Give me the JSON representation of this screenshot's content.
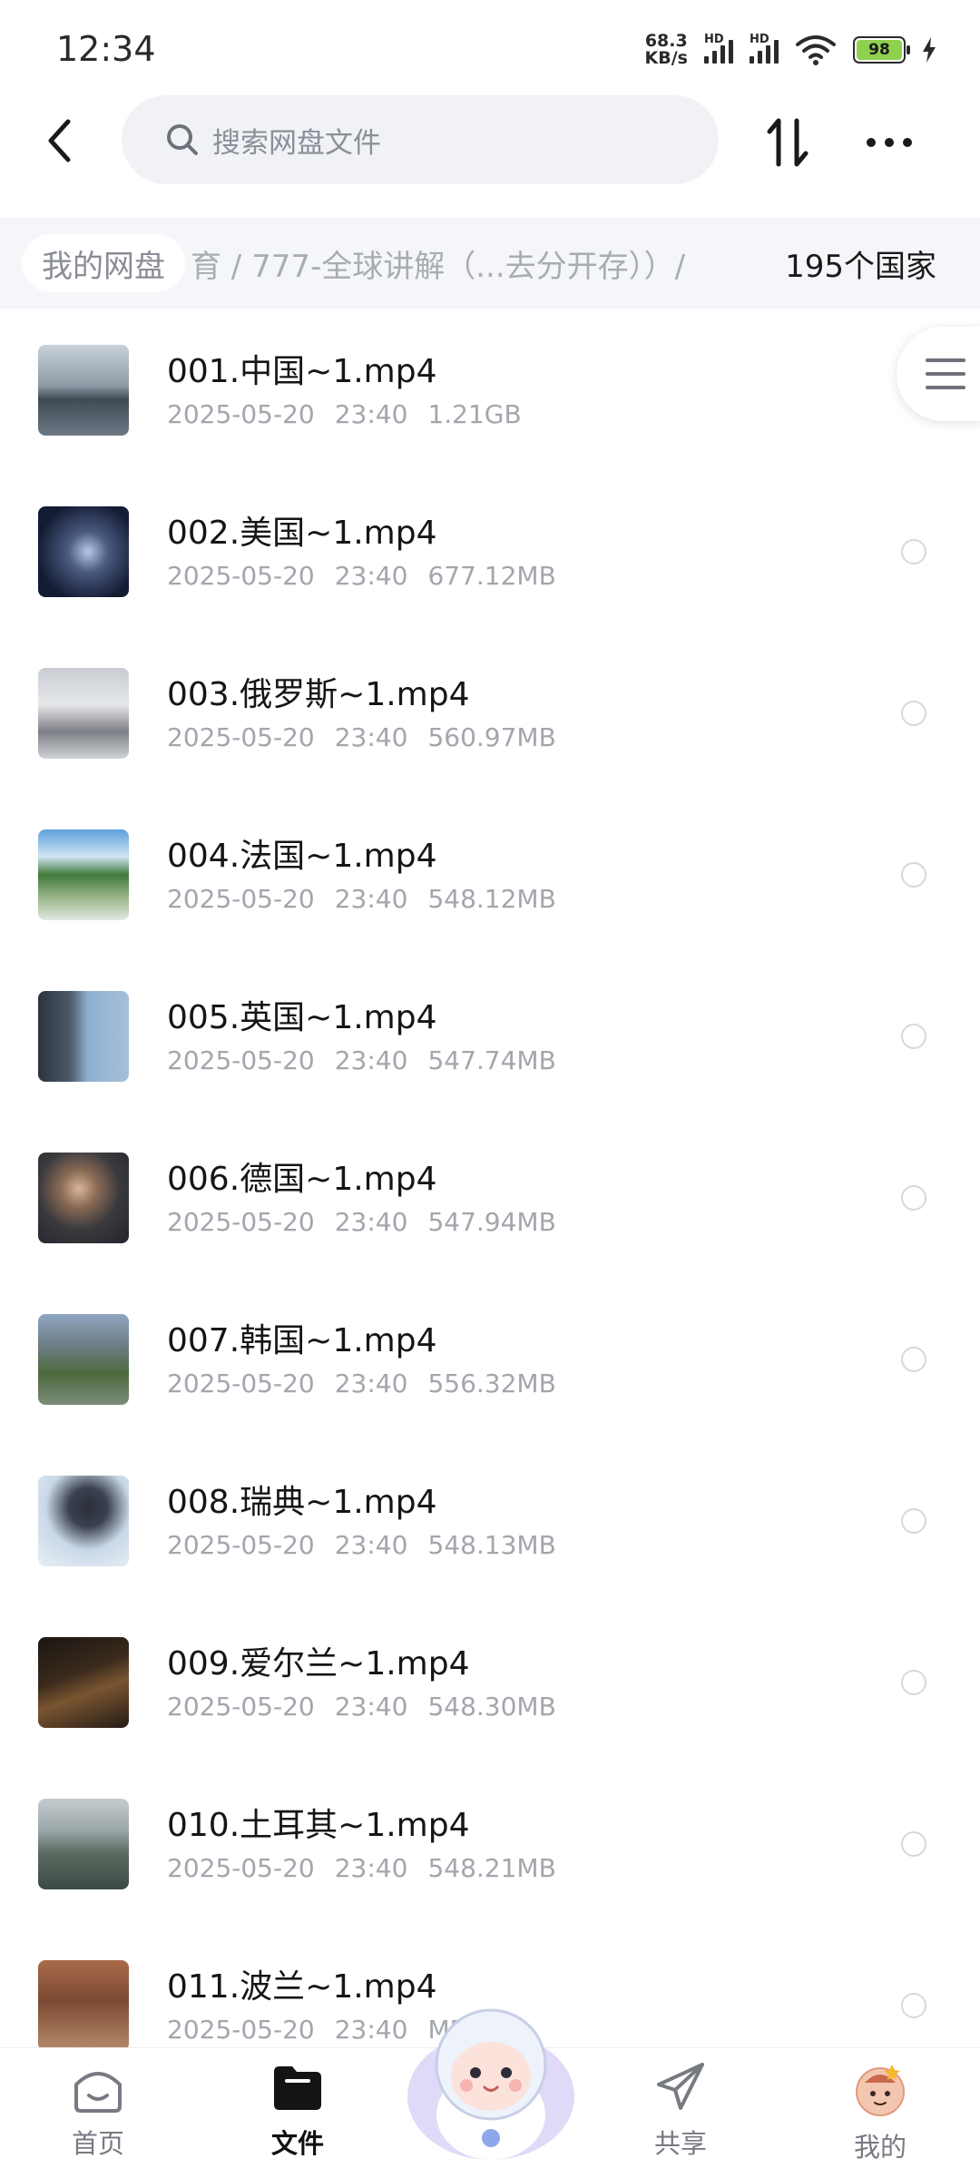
{
  "status_bar": {
    "time": "12:34",
    "net_speed_value": "68.3",
    "net_speed_unit": "KB/s",
    "signal_label": "HD",
    "battery": "98"
  },
  "search": {
    "placeholder": "搜索网盘文件"
  },
  "breadcrumb": {
    "home": "我的网盘",
    "middle": "育 / 777-全球讲解（...去分开存））/",
    "current": "195个国家"
  },
  "files": [
    {
      "name": "001.中国~1.mp4",
      "date": "2025-05-20",
      "time": "23:40",
      "size": "1.21GB"
    },
    {
      "name": "002.美国~1.mp4",
      "date": "2025-05-20",
      "time": "23:40",
      "size": "677.12MB"
    },
    {
      "name": "003.俄罗斯~1.mp4",
      "date": "2025-05-20",
      "time": "23:40",
      "size": "560.97MB"
    },
    {
      "name": "004.法国~1.mp4",
      "date": "2025-05-20",
      "time": "23:40",
      "size": "548.12MB"
    },
    {
      "name": "005.英国~1.mp4",
      "date": "2025-05-20",
      "time": "23:40",
      "size": "547.74MB"
    },
    {
      "name": "006.德国~1.mp4",
      "date": "2025-05-20",
      "time": "23:40",
      "size": "547.94MB"
    },
    {
      "name": "007.韩国~1.mp4",
      "date": "2025-05-20",
      "time": "23:40",
      "size": "556.32MB"
    },
    {
      "name": "008.瑞典~1.mp4",
      "date": "2025-05-20",
      "time": "23:40",
      "size": "548.13MB"
    },
    {
      "name": "009.爱尔兰~1.mp4",
      "date": "2025-05-20",
      "time": "23:40",
      "size": "548.30MB"
    },
    {
      "name": "010.土耳其~1.mp4",
      "date": "2025-05-20",
      "time": "23:40",
      "size": "548.21MB"
    },
    {
      "name": "011.波兰~1.mp4",
      "date": "2025-05-20",
      "time": "23:40",
      "size": "MB"
    }
  ],
  "nav": {
    "home": "首页",
    "files": "文件",
    "share": "共享",
    "mine": "我的"
  },
  "colors": {
    "accent": "#1a1a1a",
    "battery_fill": "#8fd14f",
    "search_bg": "#f1f2f5",
    "meta_text": "#a3a6ad"
  }
}
